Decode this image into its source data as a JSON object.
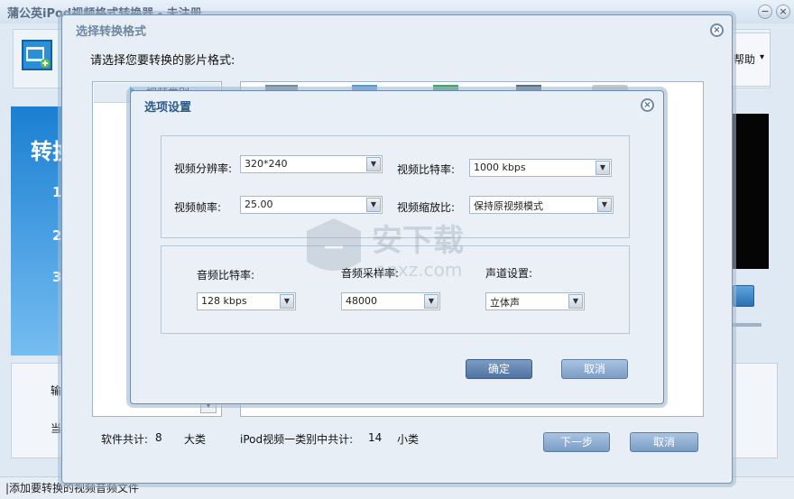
{
  "app": {
    "title": "蒲公英iPod视频格式转换器 - 未注册",
    "minimize_glyph": "−",
    "close_glyph": "×",
    "help_label": "帮助",
    "help_arrow": "▾",
    "banner_title": "转换",
    "banner_steps": [
      "1.",
      "2.",
      "3."
    ],
    "output_label": "输出",
    "current_label": "当前",
    "status_text": "|添加要转换的视频音频文件"
  },
  "format_dialog": {
    "title": "选择转换格式",
    "close_glyph": "×",
    "prompt": "请选择您要转换的影片格式:",
    "category_item": "视频类别",
    "software_total_label": "软件共计:",
    "software_total_count": "8",
    "software_total_unit": "大类",
    "ipod_total_label": "iPod视频一类别中共计:",
    "ipod_total_count": "14",
    "ipod_total_unit": "小类",
    "next_button": "下一步",
    "cancel_button": "取消"
  },
  "options_dialog": {
    "title": "选项设置",
    "close_glyph": "×",
    "video_resolution_label": "视频分辨率:",
    "video_resolution_value": "320*240",
    "video_bitrate_label": "视频比特率:",
    "video_bitrate_value": "1000 kbps",
    "video_framerate_label": "视频帧率:",
    "video_framerate_value": "25.00",
    "video_scale_label": "视频缩放比:",
    "video_scale_value": "保持原视频模式",
    "audio_bitrate_label": "音频比特率:",
    "audio_bitrate_value": "128 kbps",
    "audio_samplerate_label": "音频采样率:",
    "audio_samplerate_value": "48000",
    "audio_channel_label": "声道设置:",
    "audio_channel_value": "立体声",
    "dropdown_arrow": "▼",
    "ok_button": "确定",
    "cancel_button": "取消"
  },
  "watermark": {
    "text_cn": "安下载",
    "text_en": "anxz.com"
  }
}
